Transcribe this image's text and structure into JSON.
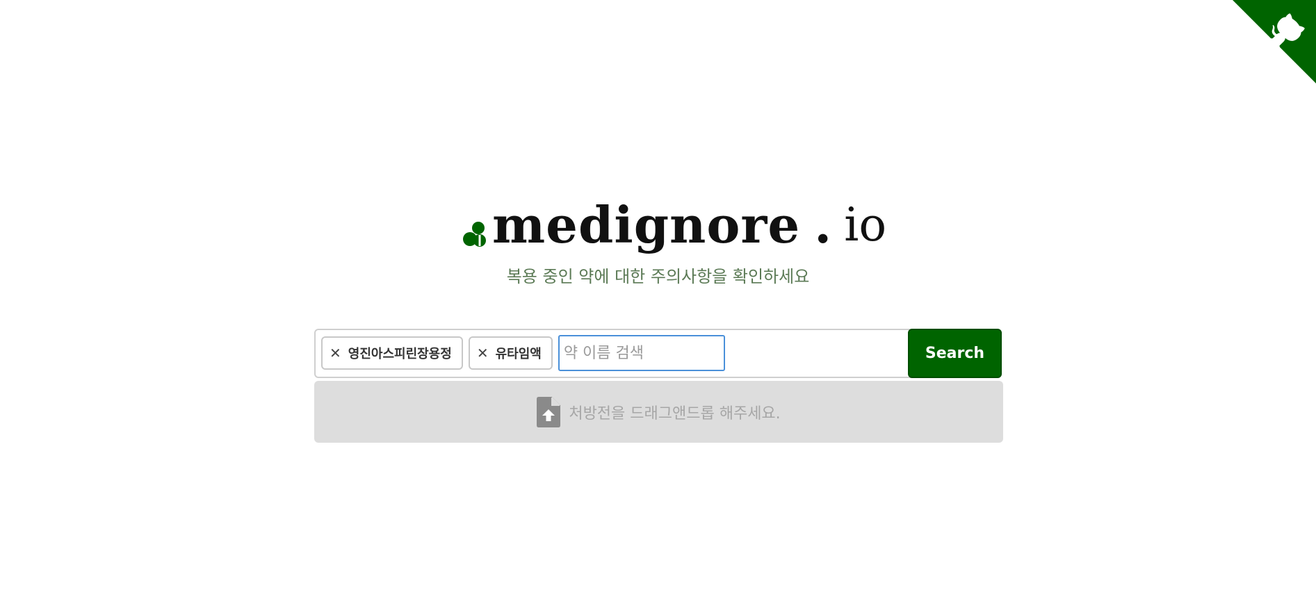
{
  "app": {
    "name": "medignore",
    "dot": ".",
    "tld": "io",
    "tagline": "복용 중인 약에 대한 주의사항을 확인하세요"
  },
  "search": {
    "selected_drugs": [
      {
        "label": "영진아스피린장용정",
        "remove_symbol": "✕"
      },
      {
        "label": "유타임액",
        "remove_symbol": "✕"
      }
    ],
    "placeholder": "약 이름 검색",
    "value": "",
    "button_label": "Search"
  },
  "dropzone": {
    "icon": "file-upload-icon",
    "text": "처방전을 드래그앤드롭 해주세요."
  },
  "corner": {
    "icon": "github-octocat-icon",
    "color": "#006400"
  },
  "colors": {
    "accent": "#006400",
    "tagline": "#5b7a55",
    "dropzone_bg": "#dddddd",
    "input_focus": "#4a90d9"
  }
}
